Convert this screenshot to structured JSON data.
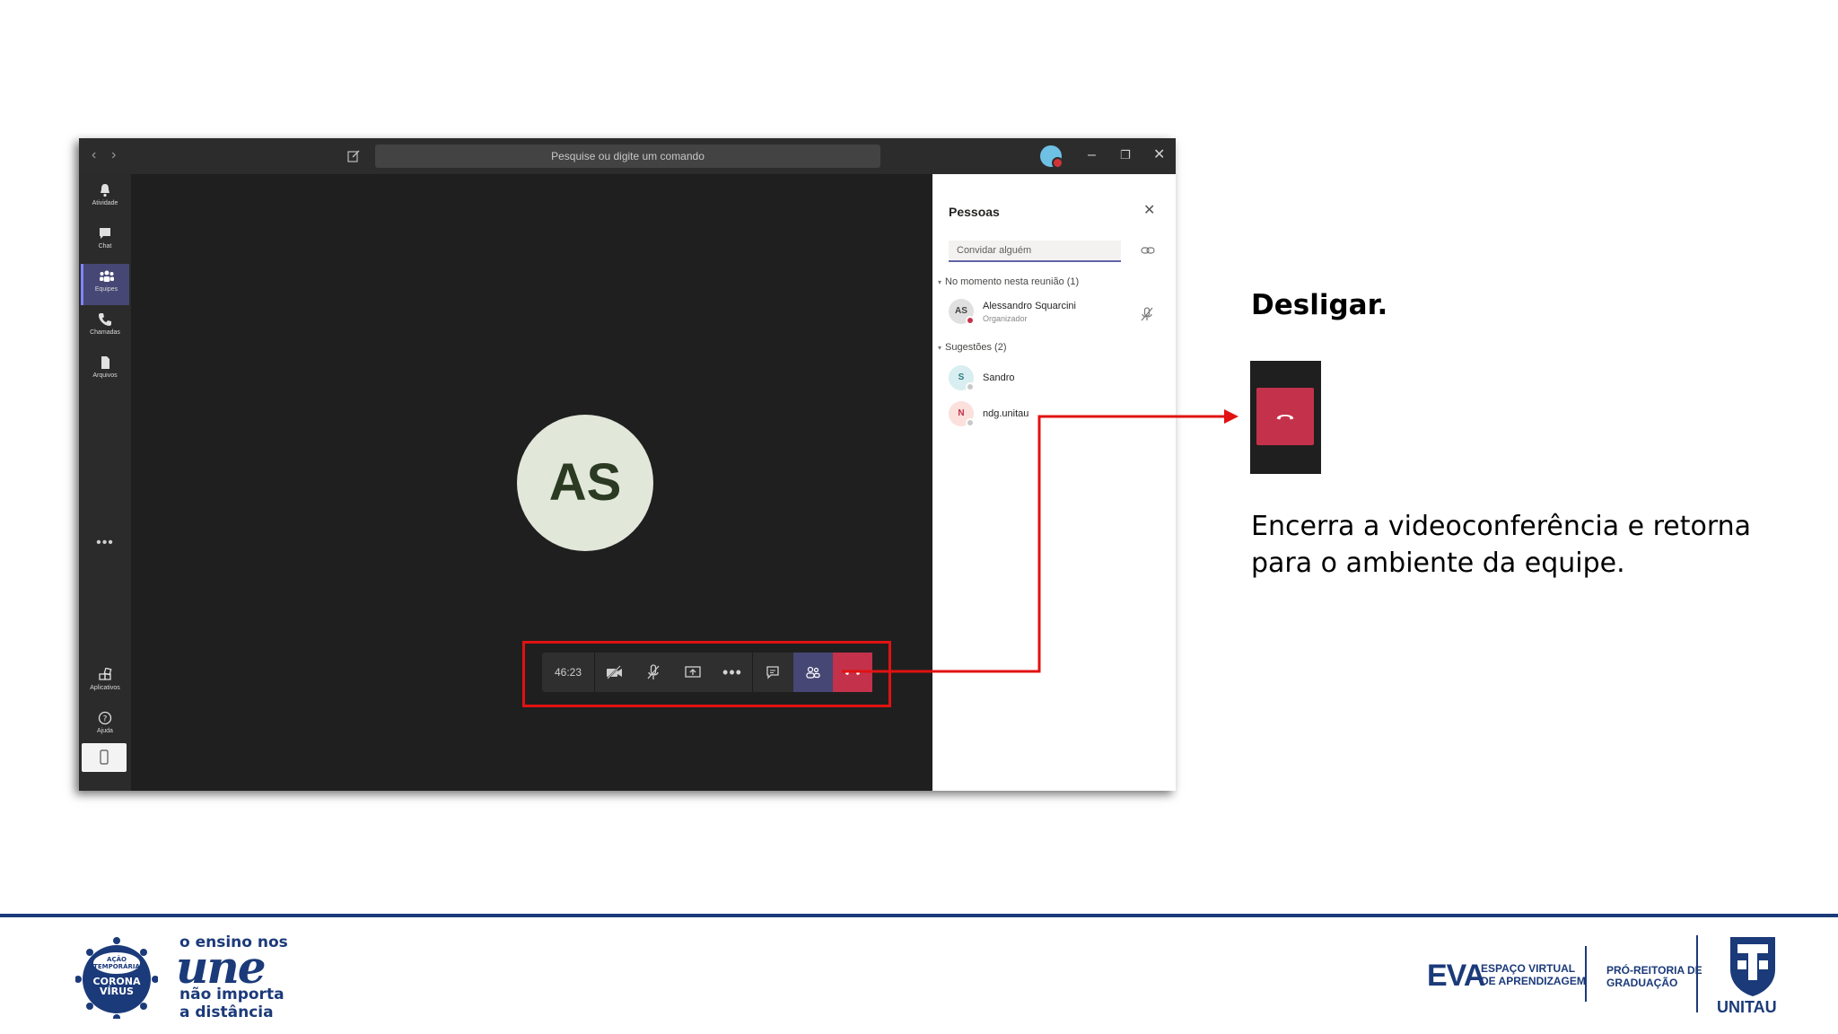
{
  "teams": {
    "search_placeholder": "Pesquise ou digite um comando",
    "rail": {
      "activity": "Atividade",
      "chat": "Chat",
      "teams": "Equipes",
      "calls": "Chamadas",
      "files": "Arquivos",
      "more": "•••",
      "apps": "Aplicativos",
      "help": "Ajuda"
    },
    "call": {
      "avatar_initials": "AS",
      "timer": "46:23"
    },
    "people_panel": {
      "title": "Pessoas",
      "invite_placeholder": "Convidar alguém",
      "in_meeting_header": "No momento nesta reunião (1)",
      "suggestions_header": "Sugestões (2)",
      "participants": [
        {
          "initials": "AS",
          "name": "Alessandro Squarcini",
          "role": "Organizador"
        }
      ],
      "suggestions": [
        {
          "initials": "S",
          "name": "Sandro"
        },
        {
          "initials": "N",
          "name": "ndg.unitau"
        }
      ]
    }
  },
  "explanation": {
    "title": "Desligar.",
    "description": "Encerra a videoconferência e retorna para o ambiente da equipe."
  },
  "footer": {
    "campaign_top": "o ensino nos",
    "campaign_big": "une",
    "campaign_line1": "não importa",
    "campaign_line2": "a distância",
    "badge_line1": "AÇÃO",
    "badge_line2": "TEMPORÁRIA",
    "badge_line3": "CORONA",
    "badge_line4": "VÍRUS",
    "eva": "EVA",
    "eva_sub1": "ESPAÇO VIRTUAL",
    "eva_sub2": "DE APRENDIZAGEM",
    "prg1": "PRÓ-REITORIA DE",
    "prg2": "GRADUAÇÃO",
    "unitau": "UNITAU"
  },
  "colors": {
    "highlight": "#e11212",
    "hangup": "#c4314b",
    "people_active": "#464775",
    "brand_blue": "#1b3a7a"
  }
}
